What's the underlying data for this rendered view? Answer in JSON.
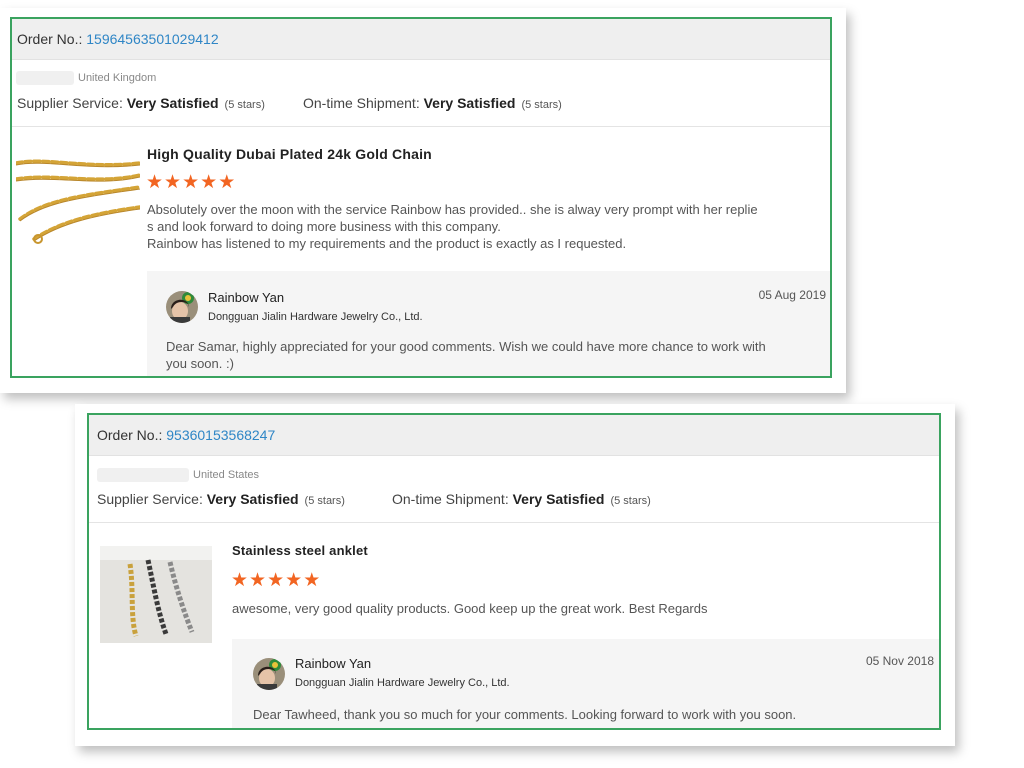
{
  "reviews": [
    {
      "order_label": "Order No.: ",
      "order_number": "15964563501029412",
      "country": "United Kingdom",
      "supplier_label": "Supplier Service: ",
      "supplier_value": "Very Satisfied",
      "supplier_stars": "(5 stars)",
      "shipment_label": "On-time Shipment: ",
      "shipment_value": "Very Satisfied",
      "shipment_stars": "(5 stars)",
      "product_title": "High Quality Dubai Plated 24k Gold Chain",
      "rating": 5,
      "review_lines": [
        "Absolutely over the moon with the service Rainbow has provided.. she is alway very  prompt with her replie",
        "s and look forward to doing more business with this company.",
        "Rainbow has listened to my requirements and the product is exactly as I requested."
      ],
      "reply": {
        "name": "Rainbow Yan",
        "company": "Dongguan Jialin Hardware Jewelry Co., Ltd.",
        "date": "05 Aug 2019",
        "lines": [
          "Dear Samar, highly appreciated for your good comments. Wish we could have more chance to work with",
          "you soon. :)"
        ]
      }
    },
    {
      "order_label": "Order No.: ",
      "order_number": "95360153568247",
      "country": "United States",
      "supplier_label": "Supplier Service: ",
      "supplier_value": "Very Satisfied",
      "supplier_stars": "(5 stars)",
      "shipment_label": "On-time Shipment: ",
      "shipment_value": "Very Satisfied",
      "shipment_stars": "(5 stars)",
      "product_title": "Stainless steel anklet",
      "rating": 5,
      "review_lines": [
        "awesome, very good quality products. Good keep up the great work. Best Regards"
      ],
      "reply": {
        "name": "Rainbow Yan",
        "company": "Dongguan Jialin Hardware Jewelry Co., Ltd.",
        "date": "05 Nov 2018",
        "lines": [
          "Dear Tawheed, thank you so much for your comments. Looking forward to work with you soon."
        ]
      }
    }
  ],
  "colors": {
    "accent_border": "#3aa35f",
    "order_link": "#2f86c6",
    "star": "#f26522"
  }
}
